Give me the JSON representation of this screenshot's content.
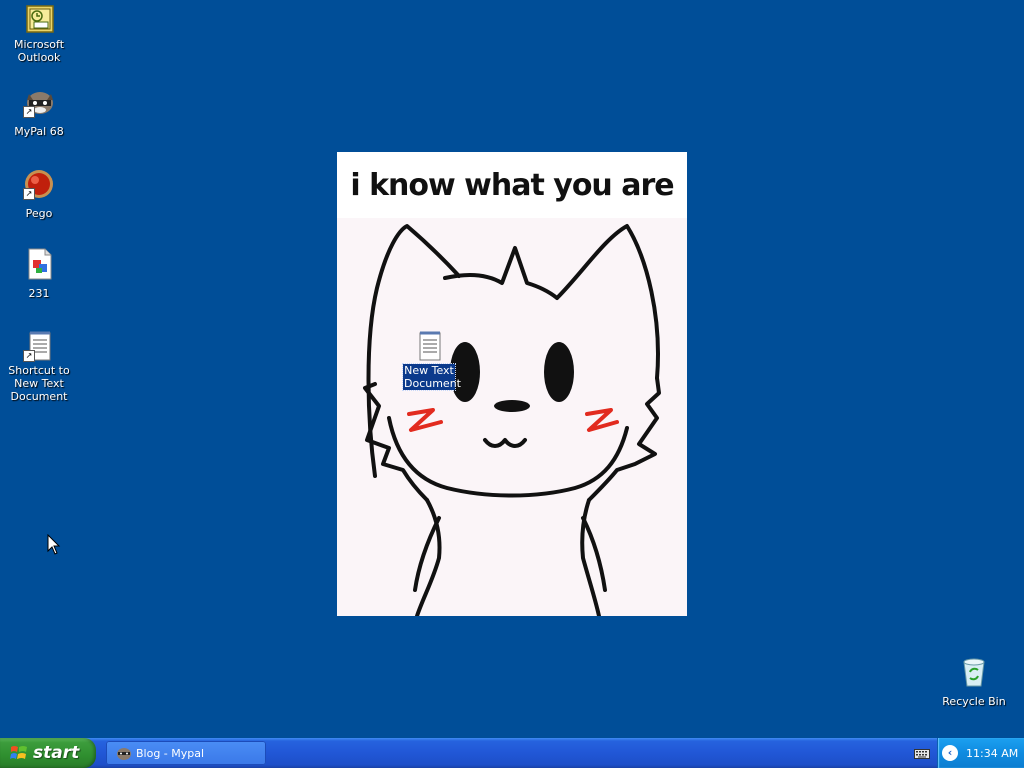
{
  "desktop": {
    "background_color": "#004e98",
    "icons": [
      {
        "label": "Microsoft Outlook",
        "icon": "outlook-icon"
      },
      {
        "label": "MyPal 68",
        "icon": "raccoon-browser-icon"
      },
      {
        "label": "Pego",
        "icon": "red-orb-icon"
      },
      {
        "label": "231",
        "icon": "image-file-icon"
      },
      {
        "label": "Shortcut to New Text Document",
        "icon": "text-document-icon"
      },
      {
        "label": "New Text Document",
        "icon": "text-document-icon"
      },
      {
        "label": "Recycle Bin",
        "icon": "recycle-bin-icon"
      }
    ]
  },
  "wallpaper": {
    "caption": "i know what you are"
  },
  "taskbar": {
    "start_label": "start",
    "task_items": [
      {
        "label": "Blog - Mypal",
        "icon": "raccoon-browser-icon"
      }
    ],
    "tray": {
      "expand_icon": "chevron-left-icon",
      "keyboard_icon": "keyboard-icon",
      "clock": "11:34 AM"
    }
  }
}
